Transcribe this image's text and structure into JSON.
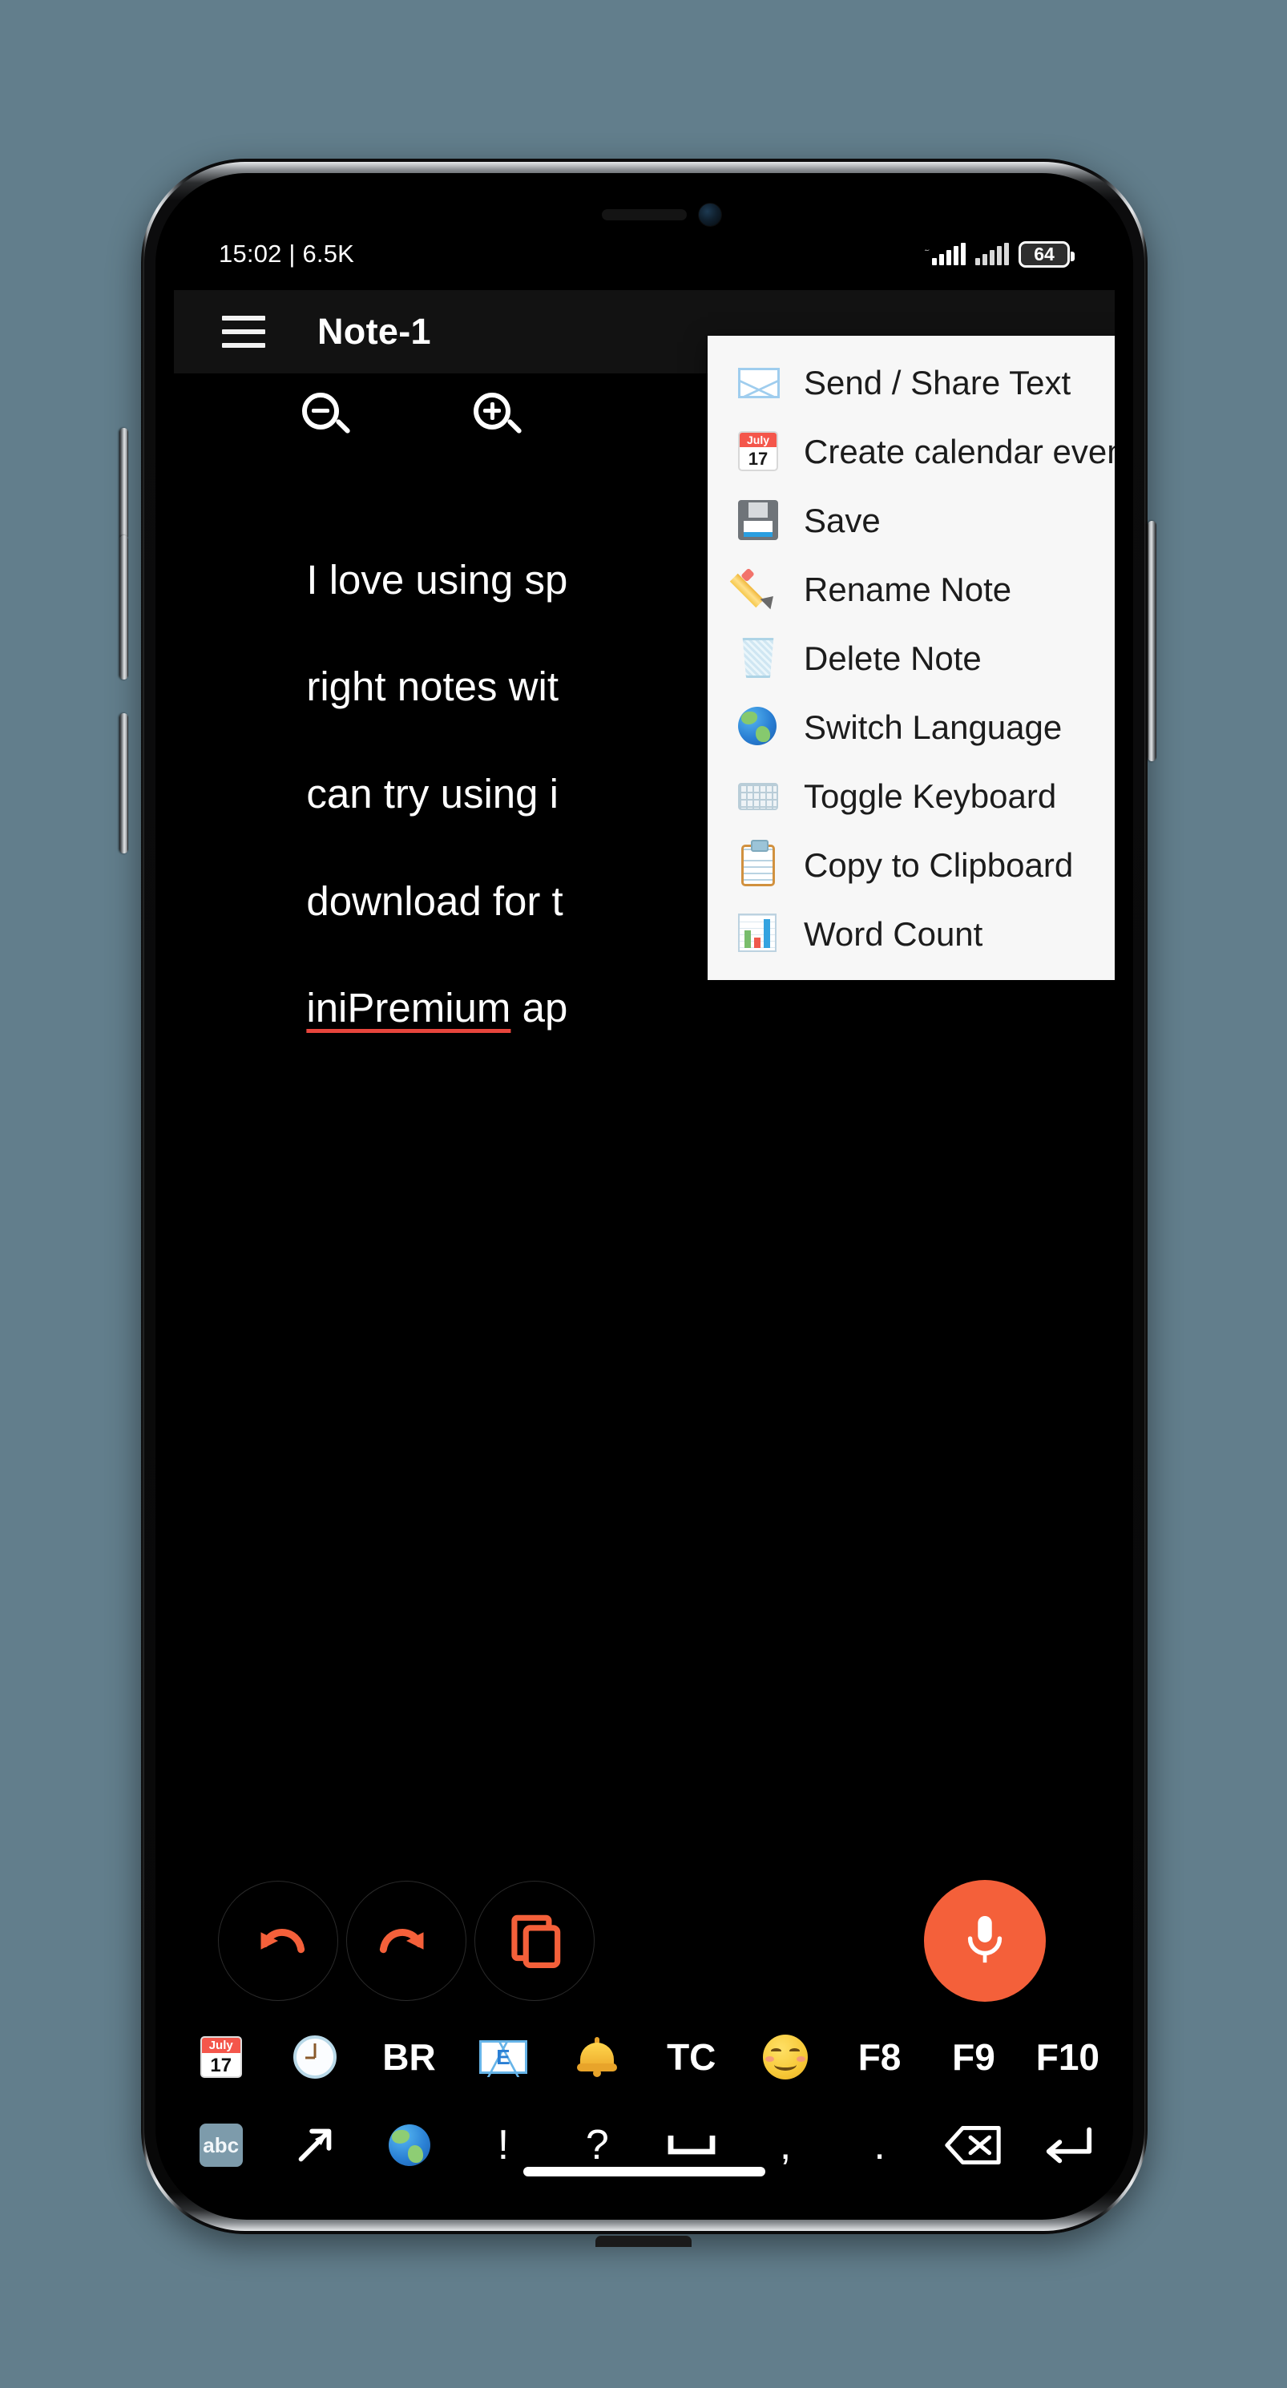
{
  "status_bar": {
    "left_text": "15:02 | 6.5K",
    "battery_level": "64",
    "signal_icon": "signal-bars-icon",
    "signal_icon_2": "signal-bars-icon-2",
    "battery_icon": "battery-icon"
  },
  "app_bar": {
    "menu_icon": "hamburger-menu-icon",
    "title": "Note-1"
  },
  "zoom_toolbar": {
    "zoom_out_icon": "zoom-out-icon",
    "zoom_in_icon": "zoom-in-icon"
  },
  "note": {
    "line1": "I love using sp",
    "line2": "right notes wit",
    "line3": "can try using i",
    "line4": "download for t",
    "line5_misspelled": "iniPremium",
    "line5_rest": " ap"
  },
  "menu": {
    "items": [
      {
        "label": "Send / Share Text",
        "icon": "envelope-icon"
      },
      {
        "label": "Create calendar event",
        "icon": "calendar-icon",
        "cal_month": "July",
        "cal_day": "17"
      },
      {
        "label": "Save",
        "icon": "floppy-disk-icon"
      },
      {
        "label": "Rename Note",
        "icon": "pencil-icon"
      },
      {
        "label": "Delete Note",
        "icon": "trash-icon"
      },
      {
        "label": "Switch Language",
        "icon": "globe-icon"
      },
      {
        "label": "Toggle Keyboard",
        "icon": "keyboard-icon"
      },
      {
        "label": "Copy to Clipboard",
        "icon": "clipboard-icon"
      },
      {
        "label": "Word Count",
        "icon": "bar-chart-icon"
      }
    ]
  },
  "action_bar": {
    "undo_icon": "undo-icon",
    "redo_icon": "redo-icon",
    "copy_icon": "copy-icon",
    "mic_icon": "microphone-icon",
    "accent_color": "#f4603a"
  },
  "keyboard": {
    "row1": [
      {
        "type": "calendar",
        "label": "",
        "month": "July",
        "day": "17",
        "icon": "calendar-key-icon"
      },
      {
        "type": "clock",
        "label": "",
        "icon": "clock-key-icon"
      },
      {
        "type": "text",
        "label": "BR",
        "icon": "br-key"
      },
      {
        "type": "mail",
        "label": "E",
        "icon": "email-key-icon"
      },
      {
        "type": "bell",
        "label": "",
        "icon": "bell-key-icon"
      },
      {
        "type": "text",
        "label": "TC",
        "icon": "tc-key"
      },
      {
        "type": "smile",
        "label": "",
        "icon": "smiley-key-icon"
      },
      {
        "type": "text",
        "label": "F8",
        "icon": "f8-key"
      },
      {
        "type": "text",
        "label": "F9",
        "icon": "f9-key"
      },
      {
        "type": "text",
        "label": "F10",
        "icon": "f10-key"
      }
    ],
    "row2": [
      {
        "type": "abc",
        "label": "abc",
        "icon": "abc-key-icon"
      },
      {
        "type": "arrow",
        "label": "",
        "icon": "arrow-up-right-icon"
      },
      {
        "type": "globe",
        "label": "",
        "icon": "globe-key-icon"
      },
      {
        "type": "sym",
        "label": "!",
        "icon": "exclamation-key"
      },
      {
        "type": "sym",
        "label": "?",
        "icon": "question-key"
      },
      {
        "type": "space",
        "label": "",
        "icon": "space-key-icon"
      },
      {
        "type": "sym",
        "label": ",",
        "icon": "comma-key"
      },
      {
        "type": "sym",
        "label": ".",
        "icon": "period-key"
      },
      {
        "type": "bksp",
        "label": "",
        "icon": "backspace-key-icon"
      },
      {
        "type": "enter",
        "label": "",
        "icon": "enter-key-icon"
      }
    ]
  },
  "device": {
    "background_color": "#627e8c",
    "home_indicator": "home-indicator"
  }
}
